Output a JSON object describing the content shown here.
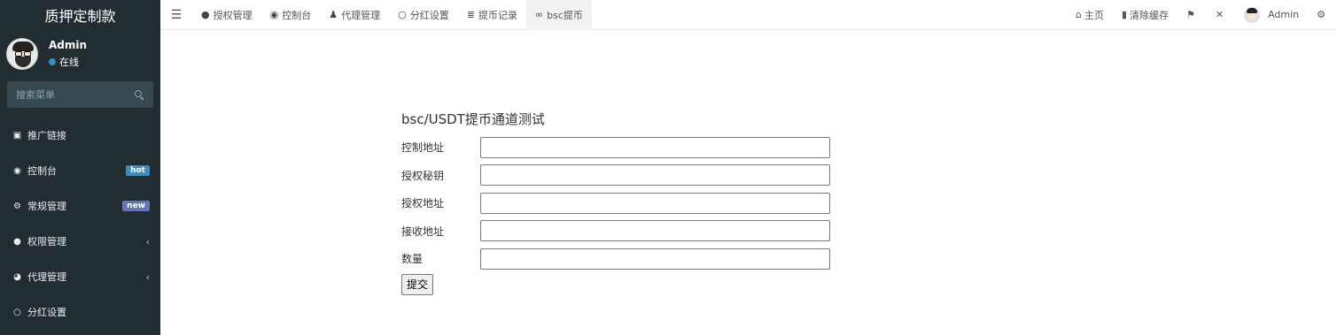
{
  "brand": {
    "title": "质押定制款"
  },
  "user": {
    "name": "Admin",
    "status": "在线"
  },
  "search": {
    "placeholder": "搜索菜单"
  },
  "sidebar": {
    "items": [
      {
        "label": "推广链接",
        "icon": "link-icon"
      },
      {
        "label": "控制台",
        "icon": "dashboard-icon",
        "badge": "hot"
      },
      {
        "label": "常规管理",
        "icon": "cogs-icon",
        "badge": "new"
      },
      {
        "label": "权限管理",
        "icon": "users-icon"
      },
      {
        "label": "代理管理",
        "icon": "user-circle-icon"
      },
      {
        "label": "分红设置",
        "icon": "circle-icon"
      }
    ]
  },
  "topbar": {
    "tabs": [
      {
        "label": "授权管理",
        "icon": "users-icon"
      },
      {
        "label": "控制台",
        "icon": "dashboard-icon"
      },
      {
        "label": "代理管理",
        "icon": "user-icon"
      },
      {
        "label": "分红设置",
        "icon": "circle-icon"
      },
      {
        "label": "提币记录",
        "icon": "list-icon"
      },
      {
        "label": "bsc提币",
        "icon": "chain-icon"
      }
    ],
    "right": {
      "home": "主页",
      "clear_cache": "清除缓存",
      "user": "Admin"
    }
  },
  "form": {
    "title": "bsc/USDT提币通道测试",
    "fields": [
      {
        "label": "控制地址",
        "value": ""
      },
      {
        "label": "授权秘钥",
        "value": ""
      },
      {
        "label": "授权地址",
        "value": ""
      },
      {
        "label": "接收地址",
        "value": ""
      },
      {
        "label": "数量",
        "value": ""
      }
    ],
    "submit_label": "提交"
  },
  "colors": {
    "sidebar_bg": "#222d32",
    "accent": "#3c8dbc",
    "badge_new": "#6675b5"
  }
}
